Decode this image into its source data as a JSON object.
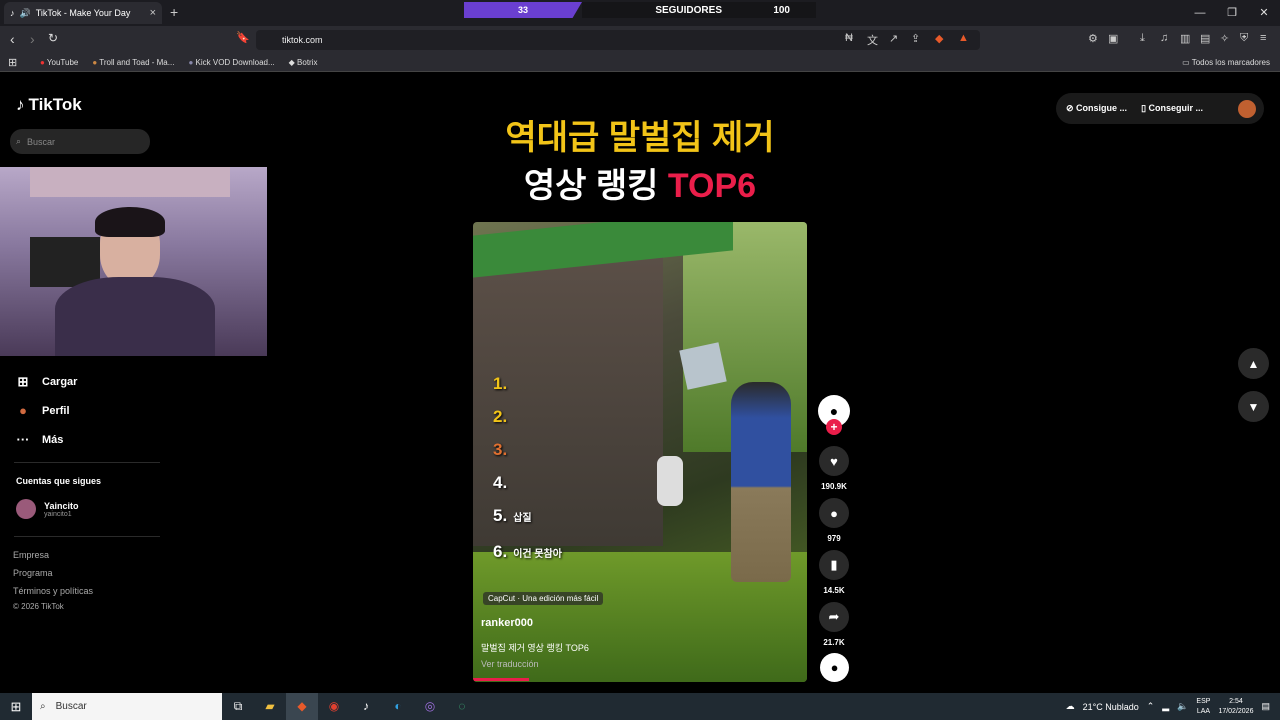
{
  "browser": {
    "tab_title": "TikTok - Make Your Day",
    "url": "tiktok.com",
    "bookmarks": [
      "YouTube",
      "Troll and Toad - Ma...",
      "Kick VOD Download...",
      "Botrix"
    ],
    "all_bookmarks": "Todos los marcadores"
  },
  "followers_bar": {
    "current": "33",
    "label": "SEGUIDORES",
    "goal": "100",
    "progress": 0.33
  },
  "tiktok": {
    "logo": "TikTok",
    "search_placeholder": "Buscar",
    "nav": {
      "upload": "Cargar",
      "profile": "Perfil",
      "more": "Más"
    },
    "following_title": "Cuentas que sigues",
    "account": {
      "name": "Yaincito",
      "handle": "yaincito1"
    },
    "footer": {
      "company": "Empresa",
      "program": "Programa",
      "terms": "Términos y políticas",
      "copyright": "© 2026 TikTok"
    },
    "top_buttons": {
      "coins": "Consigue ...",
      "app": "Conseguir ..."
    }
  },
  "video": {
    "headline_line1": "역대급 말벌집 제거",
    "headline_line2_a": "영상 랭킹 ",
    "headline_line2_b": "TOP6",
    "ranking": [
      "1.",
      "2.",
      "3.",
      "4.",
      "5.",
      "6."
    ],
    "rank5_text": "삽질",
    "rank6_text": "이건 못참아",
    "capcut": "CapCut · Una edición más fácil",
    "author": "ranker000",
    "description": "말벌집 제거 영상 랭킹 TOP6",
    "see_translation": "Ver traducción",
    "likes": "190.9K",
    "comments": "979",
    "saves": "14.5K",
    "shares": "21.7K"
  },
  "taskbar": {
    "search": "Buscar",
    "weather": "21°C  Nublado",
    "lang1": "ESP",
    "lang2": "LAA",
    "time": "2:54",
    "date": "17/02/2026"
  }
}
